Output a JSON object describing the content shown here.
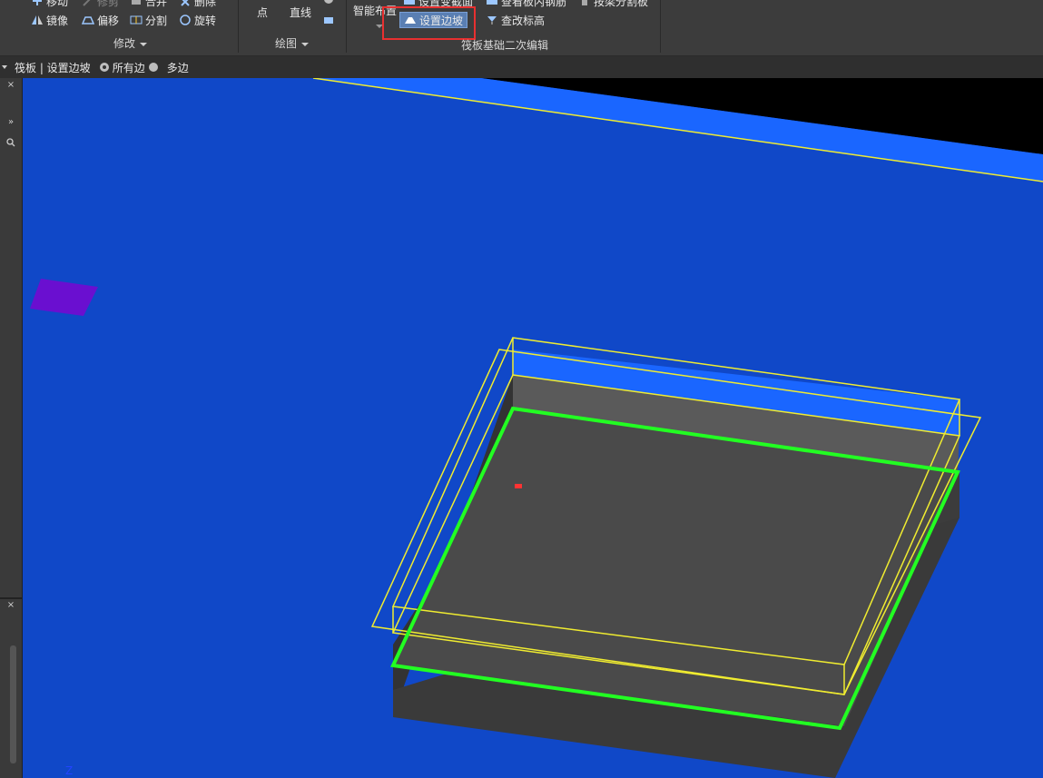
{
  "ribbon": {
    "modify": {
      "label": "修改",
      "row1": {
        "move": "移动",
        "trim": "修剪",
        "merge": "合并",
        "delete": "删除"
      },
      "row2": {
        "mirror": "镜像",
        "offset": "偏移",
        "split": "分割",
        "rotate": "旋转"
      }
    },
    "draw": {
      "label": "绘图",
      "point": "点",
      "line": "直线"
    },
    "raft": {
      "label": "筏板基础二次编辑",
      "smart_layout": "智能布置",
      "set_var_section": "设置变截面",
      "view_plate_rebar": "查看板内钢筋",
      "by_beam_split": "按梁分割板",
      "set_edge_slope": "设置边坡",
      "check_elevation": "查改标高"
    }
  },
  "options_bar": {
    "context": "筏板 | 设置边坡",
    "option_all": "所有边",
    "option_multi": "多边",
    "selected": "所有边"
  },
  "viewport": {
    "axis": "Z",
    "colors": {
      "background": "#1048c8",
      "top_strip": "#1a66ff",
      "slab": "#4a4a4a",
      "wire": "#f0ec30",
      "selection": "#22ff22",
      "marker": "#6a0fd0"
    }
  }
}
